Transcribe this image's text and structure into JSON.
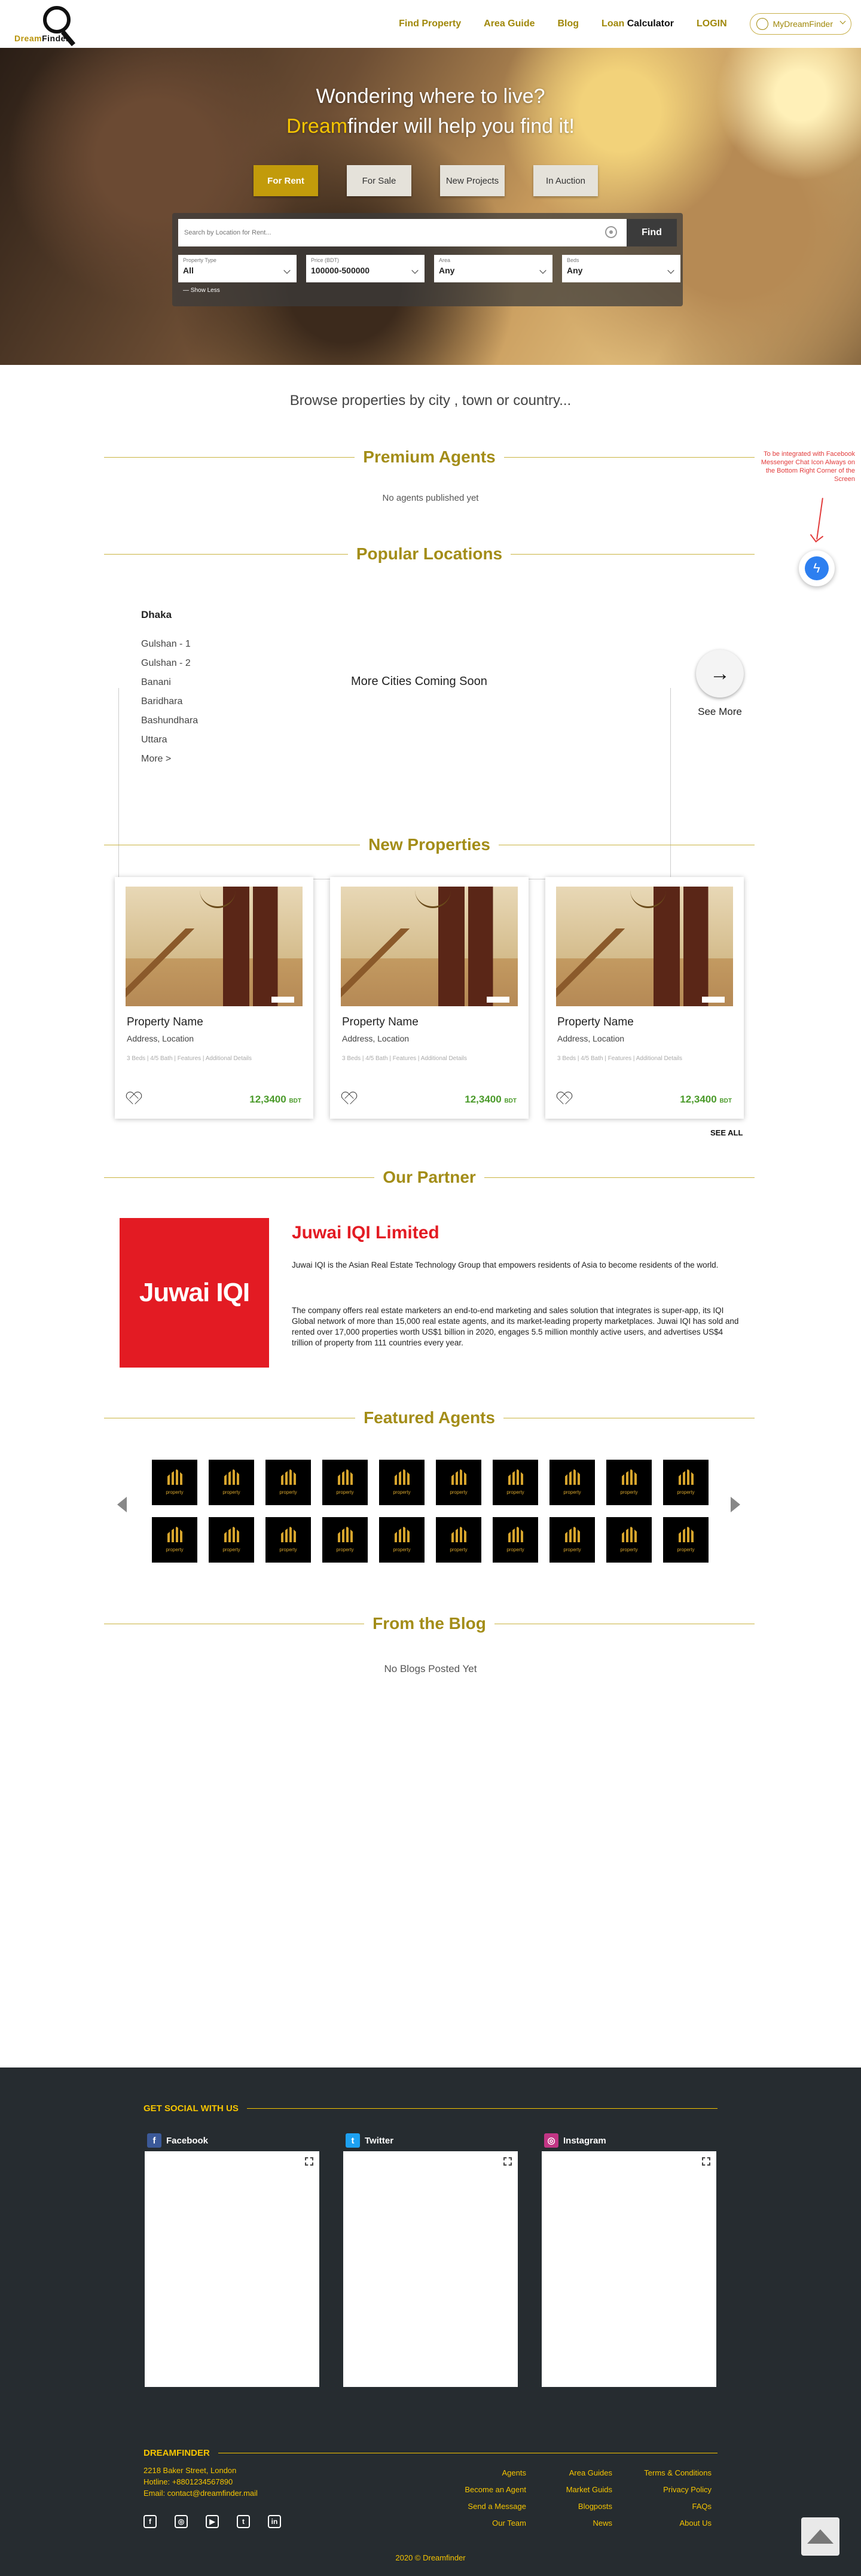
{
  "header": {
    "logo": {
      "part1": "Dream",
      "part2": "Finder"
    },
    "nav": {
      "find_property": "Find Property",
      "area_guide": "Area Guide",
      "blog": "Blog",
      "loan": "Loan",
      "calculator": "Calculator",
      "login": "LOGIN"
    },
    "account_label": "MyDreamFinder"
  },
  "hero": {
    "line1": "Wondering where to live?",
    "brand": "Dream",
    "line2_rest": "finder will help you find it!",
    "tabs": [
      "For Rent",
      "For Sale",
      "New Projects",
      "In Auction"
    ],
    "active_tab": "For Rent",
    "search_placeholder": "Search by Location for Rent...",
    "find_label": "Find",
    "filters": [
      {
        "label": "Property Type",
        "value": "All"
      },
      {
        "label": "Price (BDT)",
        "value": "100000-500000"
      },
      {
        "label": "Area",
        "value": "Any"
      },
      {
        "label": "Beds",
        "value": "Any"
      }
    ],
    "show_less": "— Show Less"
  },
  "browse_heading": "Browse properties by city , town or country...",
  "premium_agents": {
    "title": "Premium Agents",
    "empty": "No agents published yet"
  },
  "messenger_note": "To be integrated with Facebook Messenger Chat Icon Always on the Bottom Right Corner of the Screen",
  "popular_locations": {
    "title": "Popular Locations",
    "city": "Dhaka",
    "areas": [
      "Gulshan - 1",
      "Gulshan - 2",
      "Banani",
      "Baridhara",
      "Bashundhara",
      "Uttara",
      "More >"
    ],
    "coming_soon": "More Cities Coming Soon",
    "see_more": "See More"
  },
  "new_properties": {
    "title": "New Properties",
    "cards": [
      {
        "name": "Property Name",
        "address": "Address, Location",
        "details": "3 Beds | 4/5 Bath | Features | Additional Details",
        "price": "12,3400",
        "currency": "BDT"
      },
      {
        "name": "Property Name",
        "address": "Address, Location",
        "details": "3 Beds | 4/5 Bath | Features | Additional Details",
        "price": "12,3400",
        "currency": "BDT"
      },
      {
        "name": "Property Name",
        "address": "Address, Location",
        "details": "3 Beds | 4/5 Bath | Features | Additional Details",
        "price": "12,3400",
        "currency": "BDT"
      }
    ],
    "see_all": "SEE ALL"
  },
  "partner": {
    "title": "Our Partner",
    "logo_text": "Juwai IQI",
    "name": "Juwai IQI Limited",
    "p1": "Juwai IQI is the Asian Real Estate Technology Group that empowers residents of Asia to become residents of the world.",
    "p2": "The company offers real estate marketers an end-to-end marketing and sales solution that integrates is super-app, its IQI Global network of more than 15,000 real estate agents, and its market-leading property marketplaces. Juwai IQI has sold and rented over 17,000 properties worth US$1 billion in 2020, engages 5.5 million monthly active users, and advertises US$4 trillion of property from 111 countries every year."
  },
  "featured_agents": {
    "title": "Featured Agents",
    "agent_label": "property",
    "count": 20
  },
  "blog": {
    "title": "From the Blog",
    "empty": "No Blogs Posted Yet"
  },
  "footer": {
    "social_heading": "GET SOCIAL WITH US",
    "social": [
      {
        "name": "Facebook",
        "icon": "f",
        "color": "#3b5998"
      },
      {
        "name": "Twitter",
        "icon": "t",
        "color": "#1da1f2"
      },
      {
        "name": "Instagram",
        "icon": "◎",
        "color": "#c13584"
      }
    ],
    "brand_heading": "DREAMFINDER",
    "address": "2218 Baker Street, London",
    "hotline": "Hotline: +8801234567890",
    "email": "Email: contact@dreamfinder.mail",
    "col1": [
      "Agents",
      "Become an Agent",
      "Send a Message",
      "Our Team"
    ],
    "col2": [
      "Area Guides",
      "Market Guids",
      "Blogposts",
      "News"
    ],
    "col3": [
      "Terms & Conditions",
      "Privacy Policy",
      "FAQs",
      "About Us"
    ],
    "copyright": "2020 © Dreamfinder"
  }
}
